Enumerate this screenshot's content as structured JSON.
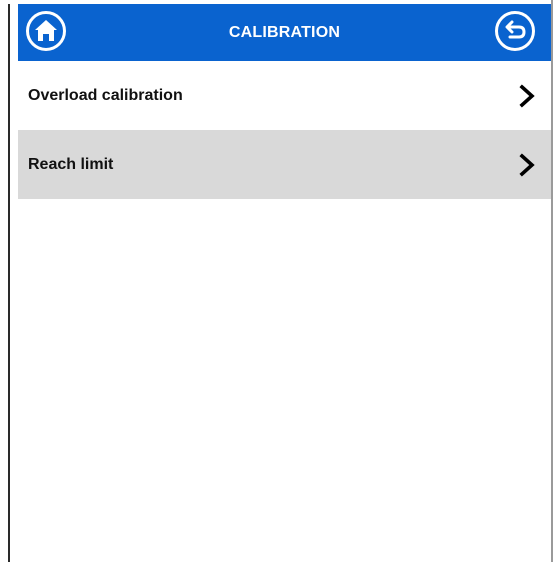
{
  "header": {
    "title": "CALIBRATION",
    "background_color": "#0a63cf",
    "home_icon": "home-icon",
    "back_icon": "back-return-icon"
  },
  "menu": {
    "items": [
      {
        "label": "Overload calibration",
        "icon": "chevron-right-icon"
      },
      {
        "label": "Reach limit",
        "icon": "chevron-right-icon"
      }
    ],
    "highlight_color": "#d9d9d9"
  }
}
